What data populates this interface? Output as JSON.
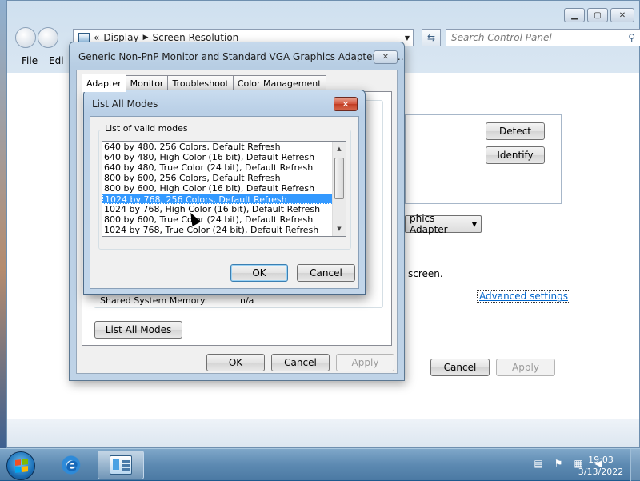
{
  "control_panel": {
    "breadcrumb": [
      "Display",
      "Screen Resolution"
    ],
    "search_placeholder": "Search Control Panel",
    "menu": [
      "File",
      "Edi"
    ],
    "detect_label": "Detect",
    "identify_label": "Identify",
    "adapter_select": "phics Adapter",
    "screen_text": "screen.",
    "advanced_link": "Advanced settings",
    "cancel_label": "Cancel",
    "apply_label": "Apply"
  },
  "properties": {
    "title": "Generic Non-PnP Monitor and Standard VGA Graphics Adapter Pro...",
    "tabs": [
      "Adapter",
      "Monitor",
      "Troubleshoot",
      "Color Management"
    ],
    "shared_memory_label": "Shared System Memory:",
    "shared_memory_value": "n/a",
    "list_all_modes_label": "List All Modes",
    "ok_label": "OK",
    "cancel_label": "Cancel",
    "apply_label": "Apply"
  },
  "modes_dialog": {
    "title": "List All Modes",
    "group_label": "List of valid modes",
    "modes": [
      "640 by 480, 256 Colors, Default Refresh",
      "640 by 480, High Color (16 bit), Default Refresh",
      "640 by 480, True Color (24 bit), Default Refresh",
      "800 by 600, 256 Colors, Default Refresh",
      "800 by 600, High Color (16 bit), Default Refresh",
      "1024 by 768, 256 Colors, Default Refresh",
      "1024 by 768, High Color (16 bit), Default Refresh",
      "800 by 600, True Color (24 bit), Default Refresh",
      "1024 by 768, True Color (24 bit), Default Refresh"
    ],
    "selected_index": 5,
    "ok_label": "OK",
    "cancel_label": "Cancel"
  },
  "taskbar": {
    "time": "19:03",
    "date": "3/13/2022"
  },
  "colors": {
    "selection": "#3399ff",
    "link": "#0066cc"
  }
}
